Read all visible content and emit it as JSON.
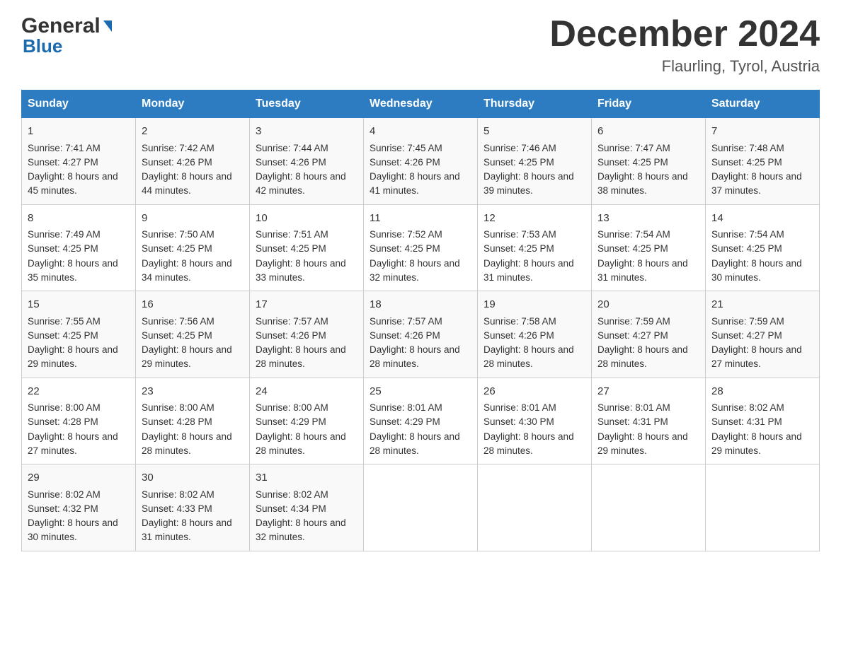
{
  "logo": {
    "line1": "General",
    "line2": "Blue"
  },
  "header": {
    "title": "December 2024",
    "subtitle": "Flaurling, Tyrol, Austria"
  },
  "days_of_week": [
    "Sunday",
    "Monday",
    "Tuesday",
    "Wednesday",
    "Thursday",
    "Friday",
    "Saturday"
  ],
  "weeks": [
    [
      {
        "day": "1",
        "sunrise": "7:41 AM",
        "sunset": "4:27 PM",
        "daylight": "8 hours and 45 minutes."
      },
      {
        "day": "2",
        "sunrise": "7:42 AM",
        "sunset": "4:26 PM",
        "daylight": "8 hours and 44 minutes."
      },
      {
        "day": "3",
        "sunrise": "7:44 AM",
        "sunset": "4:26 PM",
        "daylight": "8 hours and 42 minutes."
      },
      {
        "day": "4",
        "sunrise": "7:45 AM",
        "sunset": "4:26 PM",
        "daylight": "8 hours and 41 minutes."
      },
      {
        "day": "5",
        "sunrise": "7:46 AM",
        "sunset": "4:25 PM",
        "daylight": "8 hours and 39 minutes."
      },
      {
        "day": "6",
        "sunrise": "7:47 AM",
        "sunset": "4:25 PM",
        "daylight": "8 hours and 38 minutes."
      },
      {
        "day": "7",
        "sunrise": "7:48 AM",
        "sunset": "4:25 PM",
        "daylight": "8 hours and 37 minutes."
      }
    ],
    [
      {
        "day": "8",
        "sunrise": "7:49 AM",
        "sunset": "4:25 PM",
        "daylight": "8 hours and 35 minutes."
      },
      {
        "day": "9",
        "sunrise": "7:50 AM",
        "sunset": "4:25 PM",
        "daylight": "8 hours and 34 minutes."
      },
      {
        "day": "10",
        "sunrise": "7:51 AM",
        "sunset": "4:25 PM",
        "daylight": "8 hours and 33 minutes."
      },
      {
        "day": "11",
        "sunrise": "7:52 AM",
        "sunset": "4:25 PM",
        "daylight": "8 hours and 32 minutes."
      },
      {
        "day": "12",
        "sunrise": "7:53 AM",
        "sunset": "4:25 PM",
        "daylight": "8 hours and 31 minutes."
      },
      {
        "day": "13",
        "sunrise": "7:54 AM",
        "sunset": "4:25 PM",
        "daylight": "8 hours and 31 minutes."
      },
      {
        "day": "14",
        "sunrise": "7:54 AM",
        "sunset": "4:25 PM",
        "daylight": "8 hours and 30 minutes."
      }
    ],
    [
      {
        "day": "15",
        "sunrise": "7:55 AM",
        "sunset": "4:25 PM",
        "daylight": "8 hours and 29 minutes."
      },
      {
        "day": "16",
        "sunrise": "7:56 AM",
        "sunset": "4:25 PM",
        "daylight": "8 hours and 29 minutes."
      },
      {
        "day": "17",
        "sunrise": "7:57 AM",
        "sunset": "4:26 PM",
        "daylight": "8 hours and 28 minutes."
      },
      {
        "day": "18",
        "sunrise": "7:57 AM",
        "sunset": "4:26 PM",
        "daylight": "8 hours and 28 minutes."
      },
      {
        "day": "19",
        "sunrise": "7:58 AM",
        "sunset": "4:26 PM",
        "daylight": "8 hours and 28 minutes."
      },
      {
        "day": "20",
        "sunrise": "7:59 AM",
        "sunset": "4:27 PM",
        "daylight": "8 hours and 28 minutes."
      },
      {
        "day": "21",
        "sunrise": "7:59 AM",
        "sunset": "4:27 PM",
        "daylight": "8 hours and 27 minutes."
      }
    ],
    [
      {
        "day": "22",
        "sunrise": "8:00 AM",
        "sunset": "4:28 PM",
        "daylight": "8 hours and 27 minutes."
      },
      {
        "day": "23",
        "sunrise": "8:00 AM",
        "sunset": "4:28 PM",
        "daylight": "8 hours and 28 minutes."
      },
      {
        "day": "24",
        "sunrise": "8:00 AM",
        "sunset": "4:29 PM",
        "daylight": "8 hours and 28 minutes."
      },
      {
        "day": "25",
        "sunrise": "8:01 AM",
        "sunset": "4:29 PM",
        "daylight": "8 hours and 28 minutes."
      },
      {
        "day": "26",
        "sunrise": "8:01 AM",
        "sunset": "4:30 PM",
        "daylight": "8 hours and 28 minutes."
      },
      {
        "day": "27",
        "sunrise": "8:01 AM",
        "sunset": "4:31 PM",
        "daylight": "8 hours and 29 minutes."
      },
      {
        "day": "28",
        "sunrise": "8:02 AM",
        "sunset": "4:31 PM",
        "daylight": "8 hours and 29 minutes."
      }
    ],
    [
      {
        "day": "29",
        "sunrise": "8:02 AM",
        "sunset": "4:32 PM",
        "daylight": "8 hours and 30 minutes."
      },
      {
        "day": "30",
        "sunrise": "8:02 AM",
        "sunset": "4:33 PM",
        "daylight": "8 hours and 31 minutes."
      },
      {
        "day": "31",
        "sunrise": "8:02 AM",
        "sunset": "4:34 PM",
        "daylight": "8 hours and 32 minutes."
      },
      null,
      null,
      null,
      null
    ]
  ]
}
